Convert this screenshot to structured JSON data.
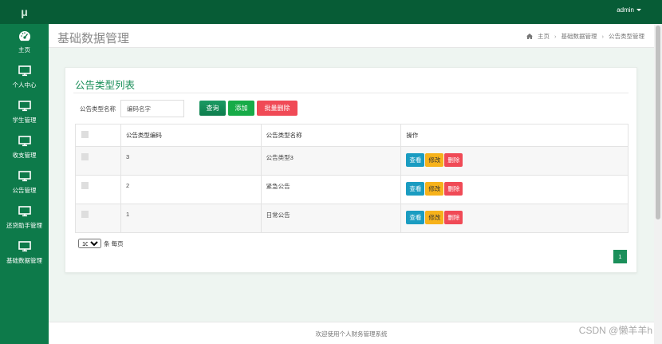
{
  "app": {
    "logo": "μ"
  },
  "topbar": {
    "user": "admin"
  },
  "sidebar": {
    "items": [
      {
        "label": "主页",
        "icon": "dashboard-icon"
      },
      {
        "label": "个人中心",
        "icon": "monitor-icon"
      },
      {
        "label": "学生管理",
        "icon": "monitor-icon"
      },
      {
        "label": "收支管理",
        "icon": "monitor-icon"
      },
      {
        "label": "公告管理",
        "icon": "monitor-icon"
      },
      {
        "label": "还贷助手管理",
        "icon": "monitor-icon"
      },
      {
        "label": "基础数据管理",
        "icon": "monitor-icon"
      }
    ]
  },
  "header": {
    "title": "基础数据管理",
    "breadcrumb": [
      "主页",
      "基础数据管理",
      "公告类型管理"
    ]
  },
  "panel": {
    "title": "公告类型列表",
    "filter_label": "公告类型名称",
    "filter_placeholder": "编码名字",
    "query_label": "查询",
    "add_label": "添加",
    "bulk_delete_label": "批量删除"
  },
  "table": {
    "headers": [
      "",
      "公告类型编码",
      "公告类型名称",
      "操作"
    ],
    "rows": [
      {
        "code": "3",
        "name": "公告类型3"
      },
      {
        "code": "2",
        "name": "紧急公告"
      },
      {
        "code": "1",
        "name": "日常公告"
      }
    ],
    "actions": {
      "view": "查看",
      "edit": "修改",
      "delete": "删除"
    }
  },
  "pagination": {
    "page_size": "10",
    "page_size_suffix": "条 每页",
    "current_page": "1"
  },
  "footer": {
    "text": "欢迎使用个人财务管理系统"
  },
  "watermark": "CSDN @懒羊羊h",
  "colors": {
    "sidebar": "#0d7a4a",
    "topbar": "#075c36",
    "accent": "#1b8f5a",
    "danger": "#f04a56",
    "warning": "#f7b21a",
    "info": "#1a9cc1"
  }
}
